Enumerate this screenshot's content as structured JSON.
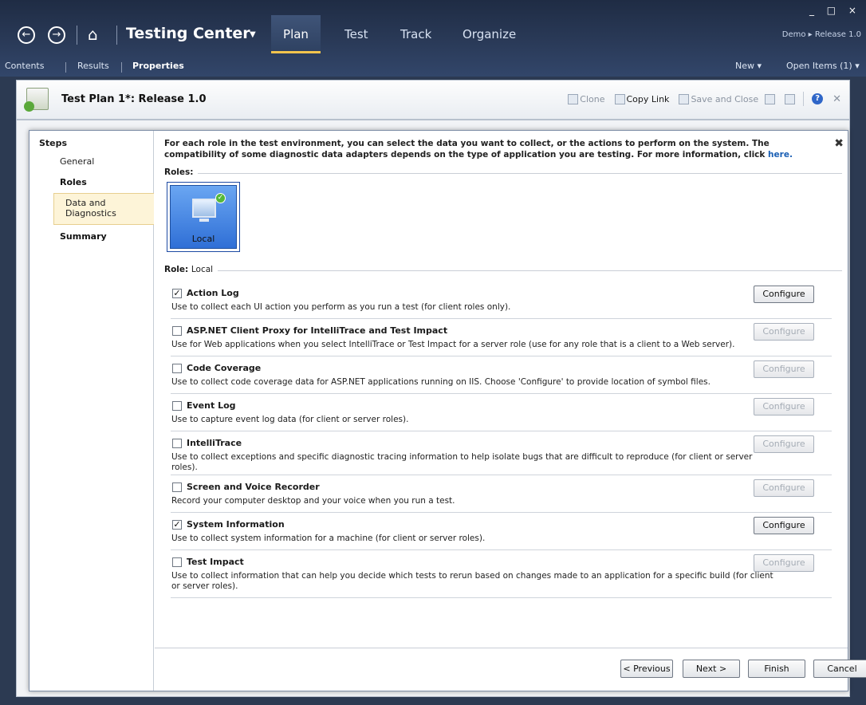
{
  "window": {
    "controls": "_ □ ×"
  },
  "nav": {
    "back_glyph": "←",
    "forward_glyph": "→",
    "home_glyph": "⌂",
    "app_title": "Testing Center",
    "dropdown_glyph": "▼",
    "tabs": [
      {
        "label": "Plan",
        "active": true
      },
      {
        "label": "Test"
      },
      {
        "label": "Track"
      },
      {
        "label": "Organize"
      }
    ],
    "breadcrumb": "Demo ▸ Release 1.0"
  },
  "subnav": {
    "items": [
      "Contents",
      "Results",
      "Properties"
    ],
    "new_label": "New ▾",
    "open_items_label": "Open Items (1) ▾"
  },
  "document": {
    "title": "Test Plan 1*: Release 1.0",
    "clone": "Clone",
    "copy_link": "Copy Link",
    "save_and_close": "Save and Close",
    "help_glyph": "?",
    "close_glyph": "✕"
  },
  "wizard": {
    "steps_header": "Steps",
    "steps": [
      "General",
      "Roles",
      "Data and Diagnostics",
      "Summary"
    ],
    "intro_text": "For each role in the test environment, you can select the data you want to collect, or the actions to perform on the system. The compatibility of some diagnostic data adapters depends on the type of application you are testing. For more information, click ",
    "intro_link": "here.",
    "close_glyph": "✖",
    "roles_label": "Roles:",
    "role_tile_name": "Local",
    "role_label": "Role:",
    "role_value": "Local",
    "configure_label": "Configure",
    "adapters": [
      {
        "name": "Action Log",
        "checked": true,
        "configurable": true,
        "description": "Use to collect each UI action you perform as you run a test (for client roles only)."
      },
      {
        "name": "ASP.NET Client Proxy for IntelliTrace and Test Impact",
        "checked": false,
        "configurable": false,
        "description": "Use for Web applications when you select IntelliTrace or Test Impact for a server role (use for any role that is a client to a Web server)."
      },
      {
        "name": "Code Coverage",
        "checked": false,
        "configurable": false,
        "description": "Use to collect code coverage data for ASP.NET applications running on IIS. Choose 'Configure' to provide location of symbol files."
      },
      {
        "name": "Event Log",
        "checked": false,
        "configurable": false,
        "description": "Use to capture event log data (for client or server roles)."
      },
      {
        "name": "IntelliTrace",
        "checked": false,
        "configurable": false,
        "description": "Use to collect exceptions and specific diagnostic tracing information to help isolate bugs that are difficult to reproduce (for client or server roles)."
      },
      {
        "name": "Screen and Voice Recorder",
        "checked": false,
        "configurable": false,
        "description": "Record your computer desktop and your voice when you run a test."
      },
      {
        "name": "System Information",
        "checked": true,
        "configurable": true,
        "description": "Use to collect system information for a machine (for client or server roles)."
      },
      {
        "name": "Test Impact",
        "checked": false,
        "configurable": false,
        "description": "Use to collect information that can help you decide which tests to rerun based on changes made to an application for a specific build (for client or server roles)."
      }
    ],
    "buttons": {
      "previous": "< Previous",
      "next": "Next >",
      "finish": "Finish",
      "cancel": "Cancel"
    }
  }
}
